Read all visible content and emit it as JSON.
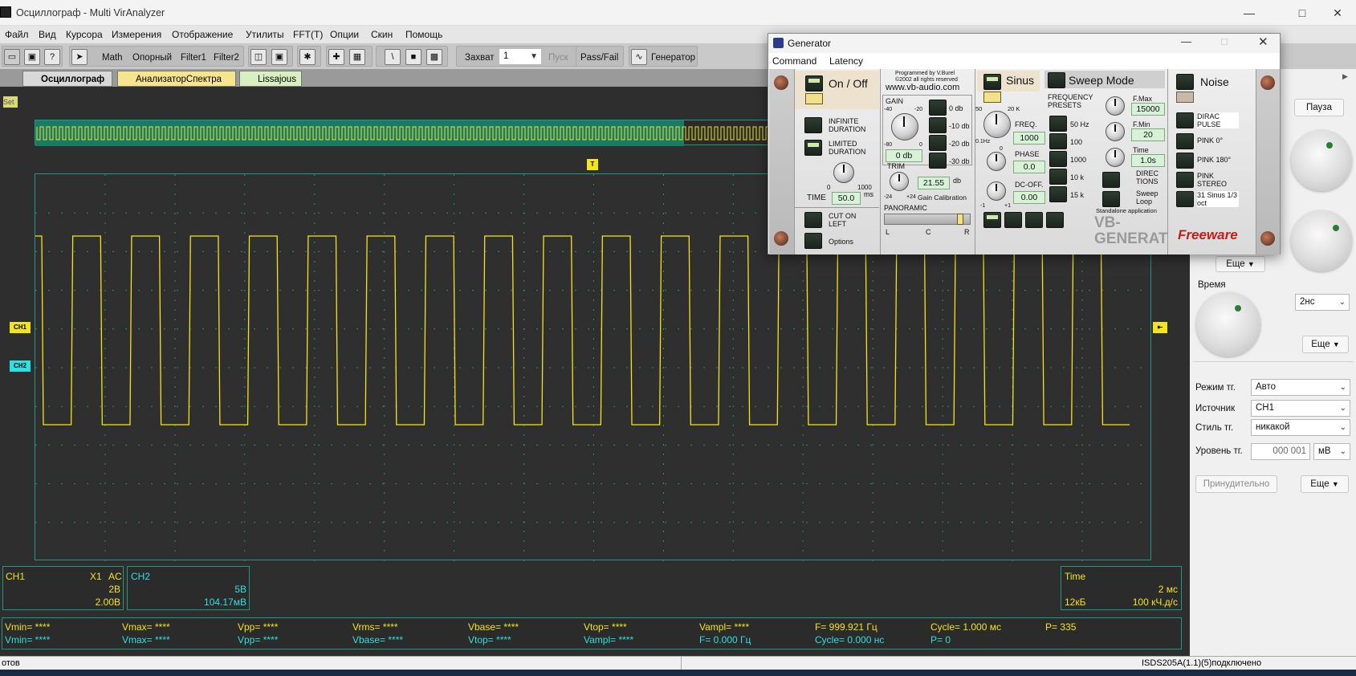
{
  "app": {
    "title": "Осциллограф - Multi VirAnalyzer"
  },
  "menu": [
    "Файл",
    "Вид",
    "Курсора",
    "Измерения",
    "Отображение",
    "Утилиты",
    "FFT(T)",
    "Опции",
    "Скин",
    "Помощь"
  ],
  "toolbar": {
    "math": "Math",
    "reference": "Опорный",
    "filter1": "Filter1",
    "filter2": "Filter2",
    "capture_label": "Захват",
    "capture_value": "1",
    "start_label": "Пуск",
    "passfail": "Pass/Fail",
    "generator": "Генератор"
  },
  "tabs": [
    {
      "label": "Осциллограф",
      "active": true
    },
    {
      "label": "АнализаторСпектра",
      "active": false
    },
    {
      "label": "Lissajous",
      "active": false
    }
  ],
  "scope": {
    "set_label": "Set",
    "trigger_marker": "T",
    "ch1_marker": "CH1",
    "ch2_marker": "CH2",
    "trace_color": "#f2e51b",
    "grid_color": "#1f9a82",
    "ch2_color": "#2ee0e0"
  },
  "channels": {
    "ch1": {
      "name": "CH1",
      "probe": "X1",
      "coupling": "AC",
      "volts_div": "2В",
      "offset": "2.00В"
    },
    "ch2": {
      "name": "CH2",
      "volts_div": "5В",
      "offset": "104.17мВ"
    }
  },
  "timebase": {
    "label": "Time",
    "div": "2 мс",
    "memory": "12кБ",
    "rate": "100 кЧ.д/с"
  },
  "measurements": {
    "row1": [
      "Vmin= ****",
      "Vmax= ****",
      "Vpp= ****",
      "Vrms= ****",
      "Vbase= ****",
      "Vtop= ****",
      "Vampl= ****",
      "F= 999.921 Гц",
      "Cycle= 1.000 мс",
      "P= 335"
    ],
    "row2": [
      "Vmin= ****",
      "Vmax= ****",
      "Vpp= ****",
      "Vbase= ****",
      "Vtop= ****",
      "Vampl= ****",
      "F= 0.000 Гц",
      "Cycle= 0.000 нс",
      "P= 0"
    ]
  },
  "status": {
    "left": "отов",
    "right": "ISDS205A(1.1)(5)подключено"
  },
  "right_panel": {
    "pause": "Пауза",
    "more1": "Еще",
    "time_label": "Время",
    "time_value": "2нс",
    "more2": "Еще",
    "trig_mode_label": "Режим тг.",
    "trig_mode_value": "Авто",
    "source_label": "Источник",
    "source_value": "CH1",
    "style_label": "Стиль тг.",
    "style_value": "никакой",
    "level_label": "Уровень тг.",
    "level_value": "000 001",
    "level_unit": "мВ",
    "force": "Принудительно",
    "more3": "Еще"
  },
  "generator": {
    "title": "Generator",
    "menu": [
      "Command",
      "Latency"
    ],
    "on_off": "On / Off",
    "infinite": "INFINITE DURATION",
    "limited": "LIMITED DURATION",
    "time_label": "TIME",
    "time_value": "50.0",
    "time_unit": "ms",
    "time_min": "0",
    "time_max": "1000",
    "cut_on_left": "CUT ON LEFT",
    "options": "Options",
    "credits1": "Programmed by V.Burel",
    "credits2": "©2002 all rights reserved",
    "website": "www.vb-audio.com",
    "gain_label": "GAIN",
    "gain_value": "0 db",
    "gain_presets": [
      "0 db",
      "-10 db",
      "-20 db",
      "-30 db"
    ],
    "gain_scale": [
      "-40",
      "-20",
      "-80",
      "0"
    ],
    "trim_label": "TRIM",
    "trim_value": "21.55",
    "trim_unit": "db",
    "trim_scale": [
      "-24",
      "+24"
    ],
    "gain_calibration": "Gain Calibration",
    "panoramic": "PANORAMIC",
    "pan_l": "L",
    "pan_c": "C",
    "pan_r": "R",
    "sinus": "Sinus",
    "sweep_mode": "Sweep Mode",
    "freq_label": "FREQ.",
    "freq_value": "1000",
    "freq_scale": [
      "50",
      "20 K",
      "0.1Hz"
    ],
    "phase_label": "PHASE",
    "phase_value": "0.0",
    "dcoff_label": "DC-OFF.",
    "dcoff_value": "0.00",
    "dc_scale": [
      "0",
      "-1",
      "+1"
    ],
    "freq_presets_label": "FREQUENCY PRESETS",
    "freq_presets": [
      "50 Hz",
      "100",
      "1000",
      "10 k",
      "15 k"
    ],
    "fmax_label": "F.Max",
    "fmax_value": "15000",
    "fmin_label": "F.Min",
    "fmin_value": "20",
    "sweep_time_label": "Time",
    "sweep_time_value": "1.0s",
    "directions": "DIREC TIONS",
    "sweep_loop": "Sweep Loop",
    "noise": "Noise",
    "noise_types": [
      "DIRAC PULSE",
      "PINK 0°",
      "PINK 180°",
      "PINK STEREO",
      "31 Sinus 1/3 oct"
    ],
    "standalone": "Standalone application",
    "brand": "VB-GENERATOR",
    "freeware": "Freeware"
  }
}
